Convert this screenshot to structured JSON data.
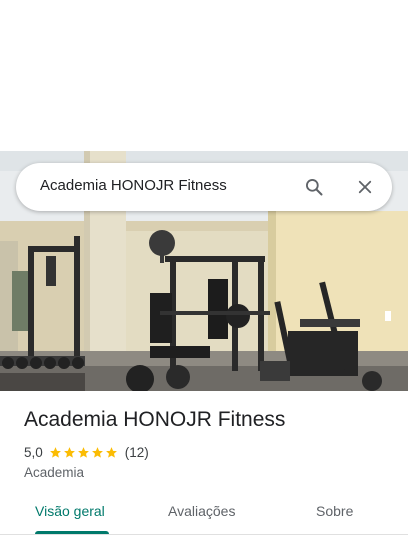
{
  "search": {
    "query": "Academia HONOJR Fitness"
  },
  "place": {
    "name": "Academia HONOJR Fitness",
    "rating": "5,0",
    "stars": 5,
    "review_count": "(12)",
    "category": "Academia"
  },
  "tabs": [
    {
      "label": "Visão geral",
      "active": true
    },
    {
      "label": "Avaliações",
      "active": false
    },
    {
      "label": "Sobre",
      "active": false
    }
  ],
  "colors": {
    "accent": "#00796b",
    "star": "#fbbc04"
  },
  "icons": [
    "search-icon",
    "close-icon",
    "star-icon"
  ]
}
